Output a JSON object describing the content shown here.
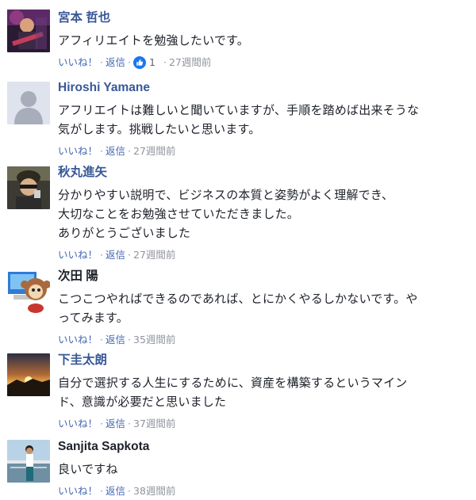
{
  "comments": [
    {
      "name": "宮本 哲也",
      "text_lines": [
        "アフィリエイトを勉強したいです。"
      ],
      "like": "いいね！",
      "reply": "返信",
      "reactions": "1",
      "time": "27週間前"
    },
    {
      "name": "Hiroshi Yamane",
      "text_lines": [
        "アフリエイトは難しいと聞いていますが、手順を踏めば出来そうな",
        "気がします。挑戦したいと思います。"
      ],
      "like": "いいね！",
      "reply": "返信",
      "time": "27週間前"
    },
    {
      "name": "秋丸進矢",
      "text_lines": [
        "分かりやすい説明で、ビジネスの本質と姿勢がよく理解でき、",
        "大切なことをお勉強させていただきました。",
        "ありがとうございました"
      ],
      "like": "いいね！",
      "reply": "返信",
      "time": "27週間前"
    },
    {
      "name": "次田 陽",
      "text_lines": [
        "こつこつやればできるのであれば、とにかくやるしかないです。や",
        "ってみます。"
      ],
      "like": "いいね！",
      "reply": "返信",
      "time": "35週間前"
    },
    {
      "name": "下圭太朗",
      "text_lines": [
        "自分で選択する人生にするために、資産を構築するというマイン",
        "ド、意識が必要だと思いました"
      ],
      "like": "いいね！",
      "reply": "返信",
      "time": "37週間前"
    },
    {
      "name": "Sanjita Sapkota",
      "text_lines": [
        "良いですね"
      ],
      "like": "いいね！",
      "reply": "返信",
      "time": "38週間前"
    }
  ],
  "separator": "·",
  "colors": {
    "name_link": "#385898",
    "action_link": "#4267b2",
    "meta_gray": "#90949c",
    "like_blue": "#1877f2"
  }
}
